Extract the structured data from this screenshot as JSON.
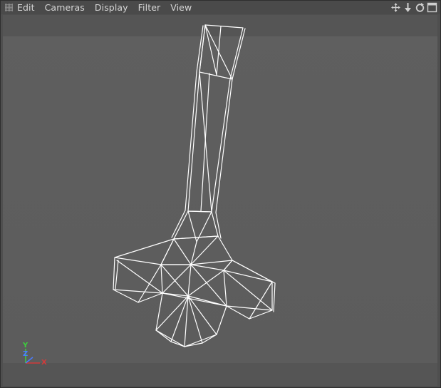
{
  "menu": {
    "items": [
      "Edit",
      "Cameras",
      "Display",
      "Filter",
      "View"
    ]
  },
  "nav_icons": [
    "move-view-icon",
    "pan-view-icon",
    "rotate-view-icon",
    "maximize-view-icon"
  ],
  "axis_gizmo": {
    "y_label": "Y",
    "z_label": "Z",
    "x_label": "X"
  },
  "colors": {
    "viewport_bg": "#5f5f5f",
    "wireframe": "#ffffff",
    "axis_x": "#d23a3a",
    "axis_y": "#3ccf3c",
    "axis_z": "#4a7cff",
    "menu_text": "#d6d6d6"
  }
}
